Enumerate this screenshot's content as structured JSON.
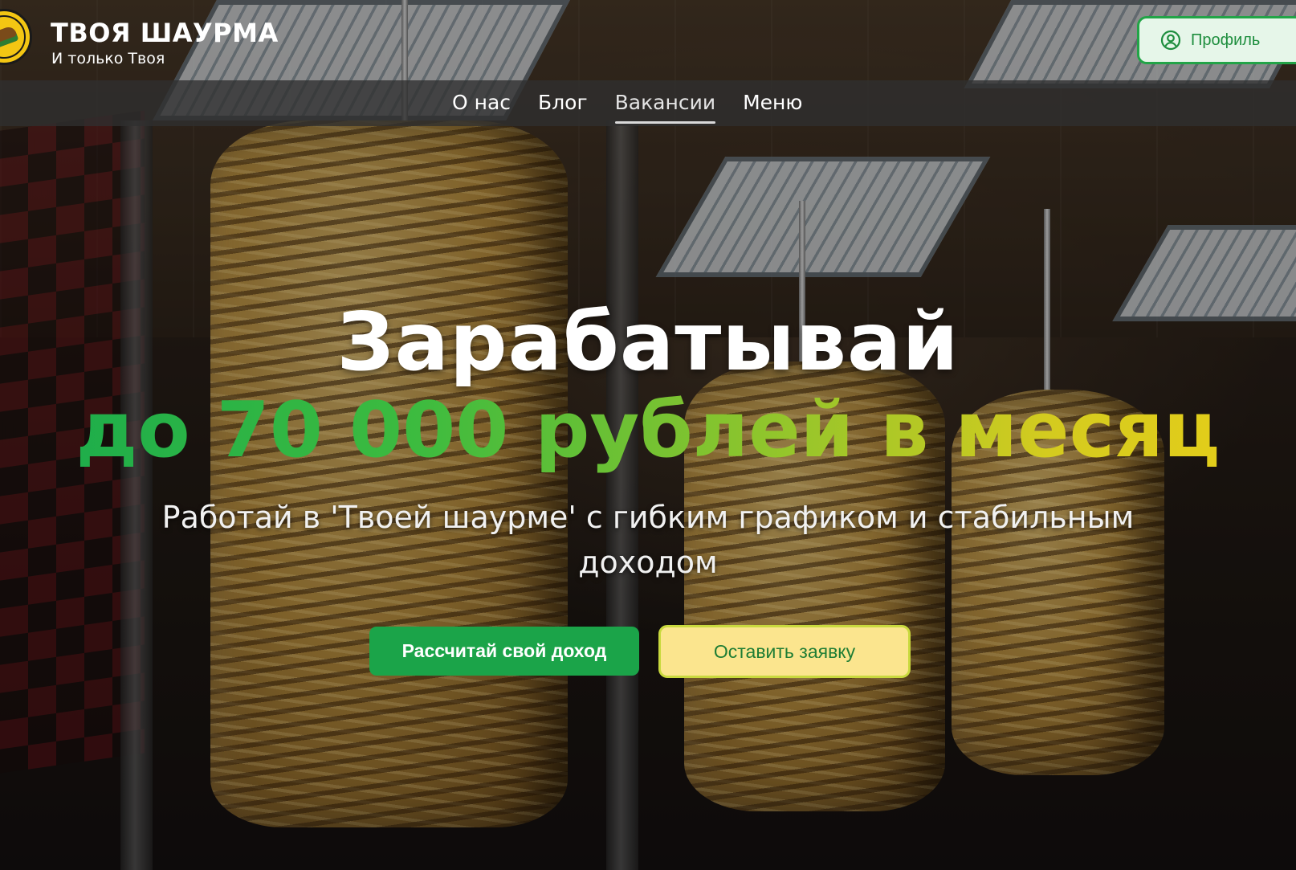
{
  "brand": {
    "title": "ТВОЯ ШАУРМА",
    "subtitle": "И только Твоя",
    "logo_text": ""
  },
  "header": {
    "profile_label": "Профиль"
  },
  "nav": {
    "items": [
      {
        "label": "О нас",
        "active": false
      },
      {
        "label": "Блог",
        "active": false
      },
      {
        "label": "Вакансии",
        "active": true
      },
      {
        "label": "Меню",
        "active": false
      }
    ]
  },
  "hero": {
    "title": "Зарабатывай",
    "accent": "до 70 000 рублей в месяц",
    "subtitle": "Работай в 'Твоей шаурме' с гибким графиком и стабильным доходом",
    "primary_cta": "Рассчитай свой доход",
    "secondary_cta": "Оставить заявку"
  },
  "colors": {
    "brand_green": "#1ba449",
    "accent_yellow": "#fbe58e",
    "gradient_start": "#1fae4a",
    "gradient_end": "#e2cd1a",
    "logo_yellow": "#f3c613"
  },
  "icons": {
    "profile": "user-circle-icon",
    "logo": "shawarma-logo-icon"
  }
}
